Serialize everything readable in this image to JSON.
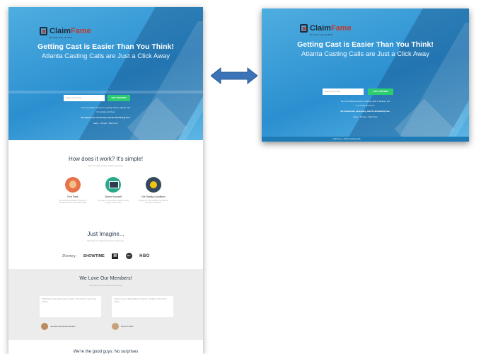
{
  "left_page": {
    "logo": {
      "claim": "Claim",
      "fame": "Fame",
      "tagline": "Be closer than you think"
    },
    "hero": {
      "title": "Getting Cast is Easier Than You Think!",
      "subtitle": "Atlanta Casting Calls are Just a Click Away",
      "email_placeholder": "Enter your email",
      "cta_label": "GET STARTED",
      "fine_print_1": "Get immediate access to casting calls in Atlanta, GA",
      "fine_print_2": "It's simple and free!",
      "fine_print_3": "No experience necessary, and its absolutely free.",
      "fine_print_4": "Easy - Simple - Risk Free"
    },
    "how": {
      "title": "How does it work? It's simple!",
      "subtitle": "Use this easy 3 step audition process.",
      "steps": [
        {
          "icon": "person-icon",
          "title": "Find Parts",
          "desc": "We search hundreds of listings in Atlanta with new information daily."
        },
        {
          "icon": "monitor-icon",
          "title": "Submit Yourself",
          "desc": "Our easy to use system makes it easy to apply for the roles."
        },
        {
          "icon": "star-icon",
          "title": "Get Ready to Audition!",
          "desc": "Prepare for your audition and get the role with confidence."
        }
      ]
    },
    "imagine": {
      "title": "Just Imagine...",
      "subtitle": "Working on projects for these networks.",
      "brands": [
        "Disney",
        "SHOWTIME",
        "M",
        "abc",
        "HBO"
      ]
    },
    "members": {
      "title": "We Love Our Members!",
      "subtitle": "See what our members are saying.",
      "quotes": [
        "ClaimFame made getting cast so simple. I found roles I never knew existed.",
        "It was so easy to find auditions in Atlanta. I booked my first role in weeks."
      ],
      "authors": [
        "Jennifer Hernandez-Evans",
        "Kevin D. Rist"
      ]
    },
    "footer_heading": "We're the good guys. No surprises"
  },
  "right_page": {
    "logo": {
      "claim": "Claim",
      "fame": "Fame",
      "tagline": "Be closer than you think"
    },
    "hero": {
      "title": "Getting Cast is Easier Than You Think!",
      "subtitle": "Atlanta Casting Calls are Just a Click Away",
      "email_placeholder": "Enter your email",
      "cta_label": "GET STARTED",
      "fine_print_1": "Get immediate access to casting calls in Atlanta, GA",
      "fine_print_2": "It's simple and free!",
      "fine_print_3": "No experience necessary, and its absolutely free.",
      "fine_print_4": "Easy - Simple - Risk Free"
    },
    "footer_bar": "ClaimFame - Atlanta Casting Calls"
  },
  "colors": {
    "hero_blue": "#2b8fd0",
    "cta_green": "#2ecc71",
    "arrow_blue": "#3b73b8",
    "brand_red": "#c0392b"
  }
}
